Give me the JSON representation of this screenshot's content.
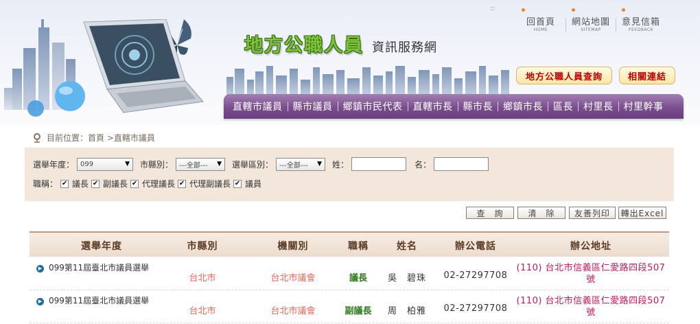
{
  "header": {
    "site_title": "地方公職人員",
    "site_subtitle": "資訊服務網",
    "top_links": [
      {
        "zh": "回首頁",
        "en": "HOME"
      },
      {
        "zh": "網站地圖",
        "en": "SITEMAP"
      },
      {
        "zh": "意見信箱",
        "en": "FEEDBACK"
      }
    ],
    "menu_dots": ":::",
    "quick_buttons": [
      "地方公職人員查詢",
      "相關連結"
    ],
    "nav": [
      "直轄市議員",
      "縣市議員",
      "鄉鎮市民代表",
      "直轄市長",
      "縣市長",
      "鄉鎮市長",
      "區長",
      "村里長",
      "村里幹事"
    ]
  },
  "breadcrumb": "目前位置：首頁 >直轄市議員",
  "search": {
    "year_label": "選舉年度：",
    "year_value": "099",
    "city_label": "市縣別：",
    "city_value": "---全部---",
    "district_label": "選舉區別：",
    "district_value": "---全部---",
    "surname_label": "姓：",
    "surname_value": "",
    "given_label": "名：",
    "given_value": "",
    "position_label": "職稱：",
    "positions": [
      {
        "label": "議長",
        "checked": true
      },
      {
        "label": "副議長",
        "checked": true
      },
      {
        "label": "代理議長",
        "checked": true
      },
      {
        "label": "代理副議長",
        "checked": true
      },
      {
        "label": "議員",
        "checked": true
      }
    ]
  },
  "actions": {
    "query": "查　詢",
    "clear": "清　除",
    "print": "友善列印",
    "excel": "轉出Excel"
  },
  "table": {
    "headers": [
      "選舉年度",
      "市縣別",
      "機關別",
      "職稱",
      "姓名",
      "辦公電話",
      "辦公地址"
    ],
    "rows": [
      {
        "year": "099第11屆臺北市議員選舉",
        "city": "台北市",
        "org": "台北市議會",
        "title": "議長",
        "name": "吳　碧珠",
        "phone": "02-27297708",
        "address": "(110) 台北市信義區仁愛路四段507號"
      },
      {
        "year": "099第11屆臺北市議員選舉",
        "city": "台北市",
        "org": "台北市議會",
        "title": "副議長",
        "name": "周　柏雅",
        "phone": "02-27297708",
        "address": "(110) 台北市信義區仁愛路四段507號"
      }
    ]
  },
  "colors": {
    "nav": "#7a4e8e",
    "title_green": "#7ec23a",
    "panel": "#f3e7dc",
    "link_red": "#e36a58",
    "address": "#c2185b"
  }
}
